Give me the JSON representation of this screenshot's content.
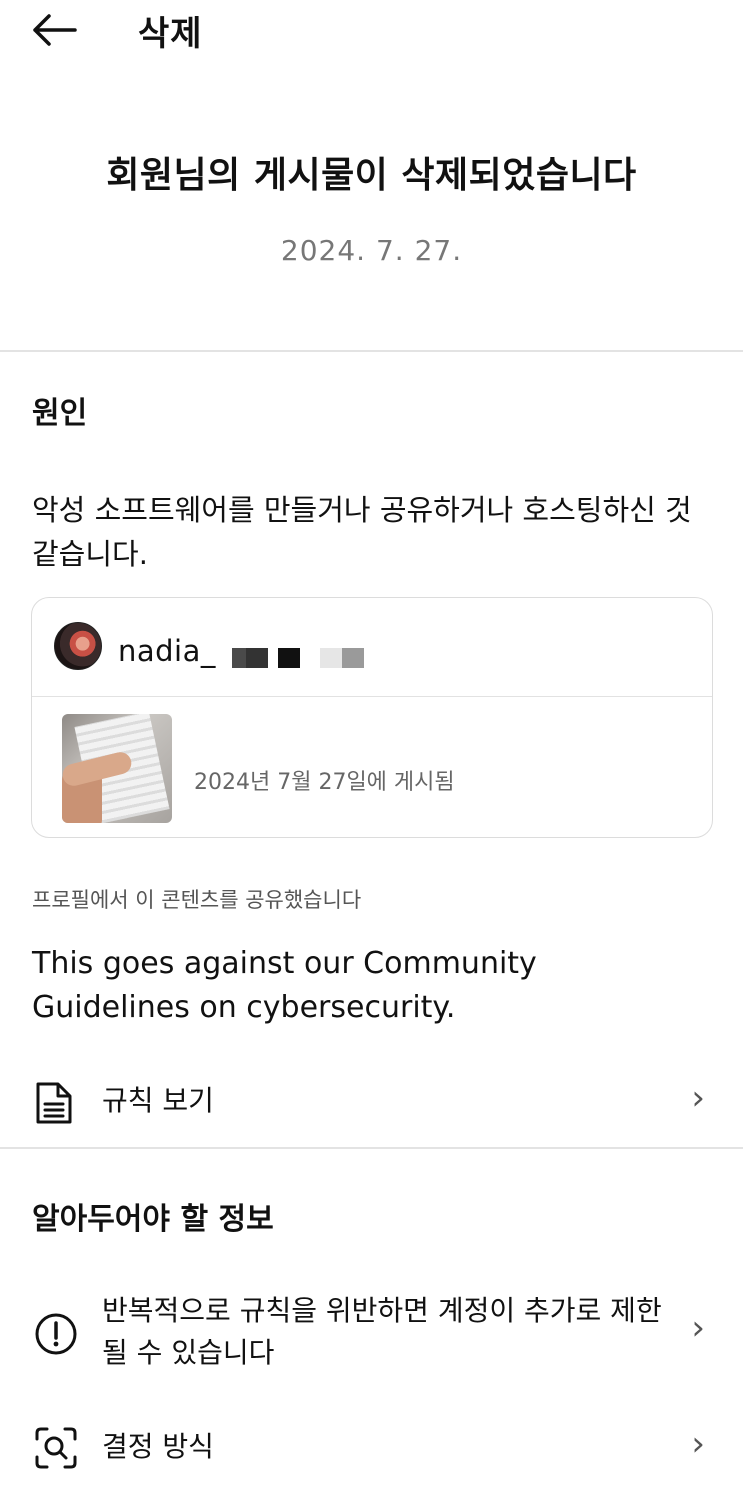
{
  "header": {
    "back_icon": "arrow-left-icon",
    "title": "삭제"
  },
  "notice": {
    "headline": "회원님의 게시물이 삭제되었습니다",
    "date": "2024. 7. 27."
  },
  "reason": {
    "title": "원인",
    "text": "악성 소프트웨어를 만들거나 공유하거나 호스팅하신 것 같습니다."
  },
  "post": {
    "username": "nadia_",
    "posted_label": "2024년 7월 27일에 게시됨"
  },
  "shared_note": "프로필에서 이 콘텐츠를 공유했습니다",
  "guideline_text": "This goes against our Community Guidelines on cybersecurity.",
  "rules_row": {
    "icon": "document-icon",
    "label": "규칙 보기"
  },
  "info": {
    "title": "알아두어야 할 정보",
    "warning_row": {
      "icon": "exclamation-circle-icon",
      "label": "반복적으로 규칙을 위반하면 계정이 추가로 제한될 수 있습니다"
    },
    "decision_row": {
      "icon": "scan-search-icon",
      "label": "결정 방식"
    }
  },
  "colors": {
    "divider": "#e3e3e3",
    "muted": "#777777",
    "text": "#111111"
  }
}
